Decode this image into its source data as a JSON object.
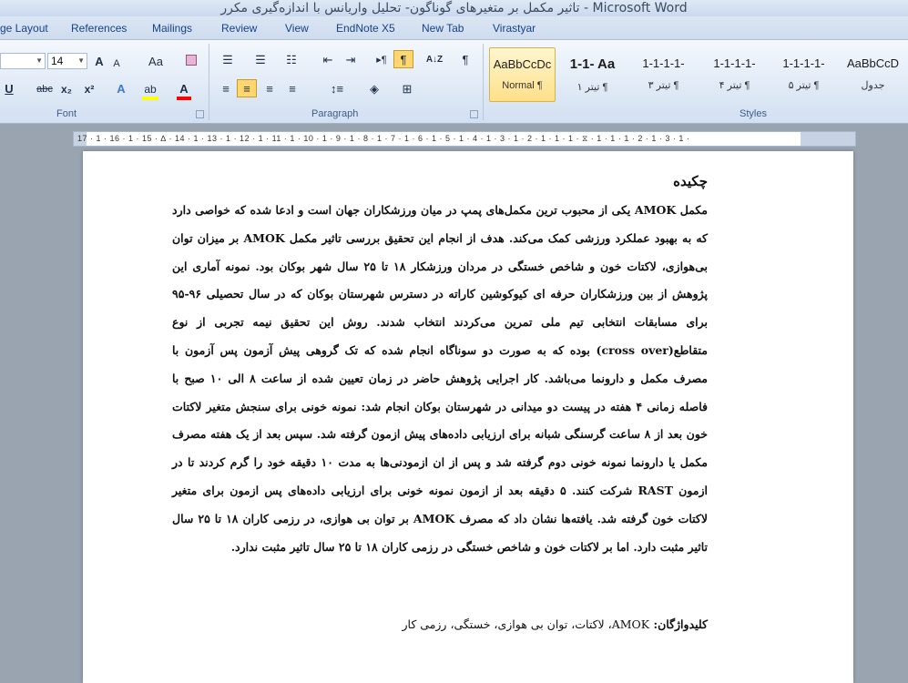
{
  "window": {
    "title": "تاثیر مکمل بر متغیرهای گوناگون- تحلیل واریانس با اندازه‌گیری مکرر - Microsoft Word"
  },
  "tabs": [
    "ge Layout",
    "References",
    "Mailings",
    "Review",
    "View",
    "EndNote X5",
    "New Tab",
    "Virastyar"
  ],
  "ribbon": {
    "font": {
      "label": "Font",
      "size": "14",
      "grow_icon": "A",
      "shrink_icon": "A",
      "change_case": "Aa",
      "clear_format_icon": "eraser-icon",
      "underline": "U",
      "strike": "abc",
      "subscript": "x₂",
      "superscript": "x²",
      "text_effect": "A",
      "highlight": "ab",
      "font_color": "A",
      "highlight_color": "#ffff00",
      "font_color_value": "#ff0000"
    },
    "paragraph": {
      "label": "Paragraph",
      "show_marks": "¶",
      "sort": "A↓Z",
      "ltr_symbol": "¶"
    },
    "styles": {
      "label": "Styles",
      "items": [
        {
          "preview": "AaBbCcDc",
          "name": "¶ Normal",
          "selected": true
        },
        {
          "preview": "1-1- Aa",
          "name": "¶ تیتر ۱",
          "selected": false
        },
        {
          "preview": "1-1-1-1-",
          "name": "¶ تیتر ۳",
          "selected": false
        },
        {
          "preview": "1-1-1-1-",
          "name": "¶ تیتر ۴",
          "selected": false
        },
        {
          "preview": "1-1-1-1-",
          "name": "¶ تیتر ۵",
          "selected": false
        },
        {
          "preview": "AaBbCcD",
          "name": "جدول",
          "selected": false
        }
      ]
    }
  },
  "ruler": {
    "left_text": "17 · 1 · 16 · 1 · 15 · ∆ · 14 · 1 · 13 · 1 · 12 · 1 · 11 · 1 · 10 · 1 · 9 · 1 · 8 · 1 · 7 · 1 · 6 · 1 · 5 · 1 · 4 · 1 · 3 · 1 · 2 · 1 · 1 · 1 · ⧖ · 1 · 1 · 1 · 2 · 1 · 3 · 1 ·"
  },
  "document": {
    "heading": "چکیده",
    "body": "مکمل AMOK یکی از محبوب ترین مکمل‌های پمپ در میان ورزشکاران جهان است و ادعا شده که خواصی دارد که به بهبود عملکرد ورزشی کمک می‌کند. هدف از انجام این تحقیق بررسی تاثیر مکمل AMOK بر میزان توان بی‌هوازی، لاکتات خون و شاخص خستگی در مردان ورزشکار ۱۸ تا ۲۵ سال شهر بوکان بود. نمونه آماری این پژوهش از بین ورزشکاران حرفه ای کیوکوشین کاراته در دسترس شهرستان بوکان که در سال تحصیلی ۹۶-۹۵ برای مسابقات انتخابی تیم ملی تمرین می‌کردند انتخاب شدند. روش این تحقیق نیمه تجربی از نوع متقاطع(cross over) بوده که به صورت دو سوناگاه انجام شده که تک گروهی پیش آزمون پس آزمون با مصرف مکمل و دارونما می‌باشد. کار اجرایی پژوهش حاضر در زمان تعیین شده از ساعت ۸ الی ۱۰ صبح با فاصله زمانی ۴ هفته در پیست دو میدانی در شهرستان بوکان انجام شد: نمونه خونی برای سنجش متغیر لاکتات خون بعد از ۸ ساعت گرسنگی شبانه برای ارزیابی داده‌های پیش ازمون گرفته شد. سپس بعد از یک هفته مصرف مکمل یا دارونما نمونه خونی دوم گرفته شد و پس از ان ازمودنی‌ها به مدت ۱۰ دقیقه خود را گرم کردند تا در ازمون RAST شرکت کنند. ۵ دقیقه بعد از ازمون نمونه خونی برای ارزیابی داده‌های پس ازمون برای متغیر لاکتات خون گرفته شد. یافته‌ها نشان داد که مصرف AMOK بر توان بی هوازی، در رزمی کاران ۱۸ تا ۲۵ سال تاثیر مثبت دارد. اما بر لاکتات خون و شاخص خستگی در رزمی کاران ۱۸ تا ۲۵ سال تاثیر مثبت ندارد.",
    "keywords_label": "کلیدواژگان:",
    "keywords": "AMOK، لاکتات، توان بی هوازی، خستگی، رزمی کار"
  }
}
